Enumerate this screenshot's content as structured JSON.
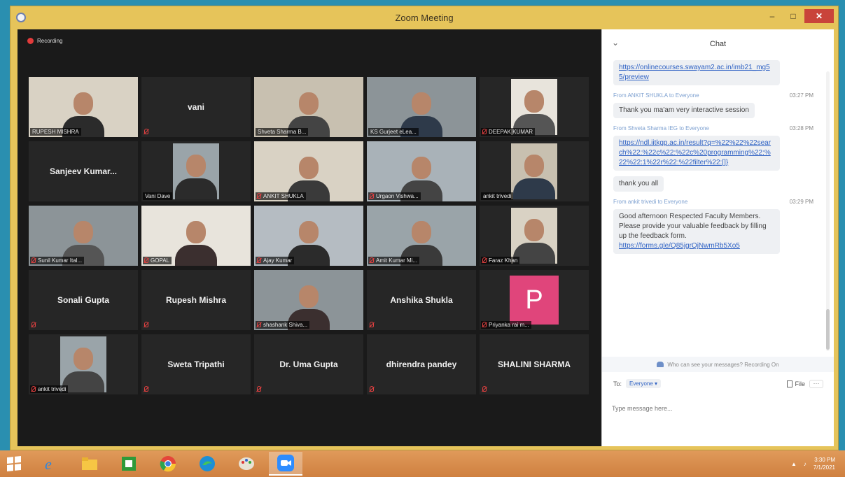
{
  "window": {
    "title": "Zoom Meeting"
  },
  "recording": {
    "label": "Recording"
  },
  "participants": [
    {
      "name": "RUPESH MISHRA",
      "type": "video",
      "active": true,
      "muted": false
    },
    {
      "name": "vani",
      "type": "name",
      "muted": true
    },
    {
      "name": "Shveta Sharma B...",
      "type": "video",
      "muted": false
    },
    {
      "name": "KS Gurjeet  eLea...",
      "type": "video",
      "muted": false
    },
    {
      "name": "DEEPAK KUMAR",
      "type": "video",
      "muted": true
    },
    {
      "name": "Sanjeev  Kumar...",
      "type": "name",
      "muted": false
    },
    {
      "name": "Vani Dave",
      "type": "video",
      "muted": false
    },
    {
      "name": "ANKIT SHUKLA",
      "type": "video",
      "muted": true
    },
    {
      "name": "Urgaon Vishwa...",
      "type": "video",
      "muted": true
    },
    {
      "name": "ankit trivedi",
      "type": "video",
      "muted": false
    },
    {
      "name": "Sunil Kumar Ital...",
      "type": "video",
      "muted": true
    },
    {
      "name": "GOPAL",
      "type": "video",
      "muted": true
    },
    {
      "name": "Ajay Kumar",
      "type": "video",
      "muted": true
    },
    {
      "name": "Amit Kumar Mi...",
      "type": "video",
      "muted": true
    },
    {
      "name": "Faraz Khan",
      "type": "video",
      "muted": true
    },
    {
      "name": "Sonali Gupta",
      "type": "name",
      "muted": true
    },
    {
      "name": "Rupesh Mishra",
      "type": "name",
      "muted": true
    },
    {
      "name": "shashank Shiva...",
      "type": "video",
      "muted": true
    },
    {
      "name": "Anshika Shukla",
      "type": "name",
      "muted": true
    },
    {
      "name": "Priyanka rai m...",
      "type": "avatar",
      "initial": "P",
      "muted": true
    },
    {
      "name": "ankit trivedi",
      "type": "video",
      "muted": true
    },
    {
      "name": "Sweta Tripathi",
      "type": "name",
      "muted": true
    },
    {
      "name": "Dr. Uma Gupta",
      "type": "name",
      "muted": true
    },
    {
      "name": "dhirendra pandey",
      "type": "name",
      "muted": true
    },
    {
      "name": "SHALINI SHARMA",
      "type": "name",
      "muted": true
    }
  ],
  "chat": {
    "title": "Chat",
    "messages": [
      {
        "from": "",
        "time": "",
        "text": "",
        "link": "https://onlinecourses.swayam2.ac.in/imb21_mg55/preview"
      },
      {
        "from": "From ANKIT SHUKLA to Everyone",
        "time": "03:27 PM",
        "text": "Thank you ma'am very interactive session",
        "link": ""
      },
      {
        "from": "From Shveta Sharma IEG to Everyone",
        "time": "03:28 PM",
        "text": "",
        "link": "https://ndl.iitkgp.ac.in/result?q=%22%22%22search%22:%22c%22:%22c%20programming%22:%22%22:1%22r%22:%22filter%22:[]}"
      },
      {
        "from": "",
        "time": "",
        "text": "thank you all",
        "link": ""
      },
      {
        "from": "From ankit trivedi to Everyone",
        "time": "03:29 PM",
        "text": "Good afternoon Respected Faculty Members.\nPlease provide your valuable feedback by filling up the feedback form.",
        "link": "https://forms.gle/Q85jgrQjNwmRb5Xo5"
      }
    ],
    "notice": "Who can see your messages? Recording On",
    "to_label": "To:",
    "to_value": "Everyone",
    "file_label": "File",
    "more_label": "···",
    "input_placeholder": "Type message here..."
  },
  "taskbar": {
    "clock_time": "3:30 PM",
    "clock_date": "7/1/2021"
  },
  "colors": {
    "zoom_dark": "#1a1a1a",
    "active_speaker": "#c7d93a",
    "muted_red": "#e04040",
    "link_blue": "#2f62c4",
    "avatar_pink": "#e0457b"
  }
}
